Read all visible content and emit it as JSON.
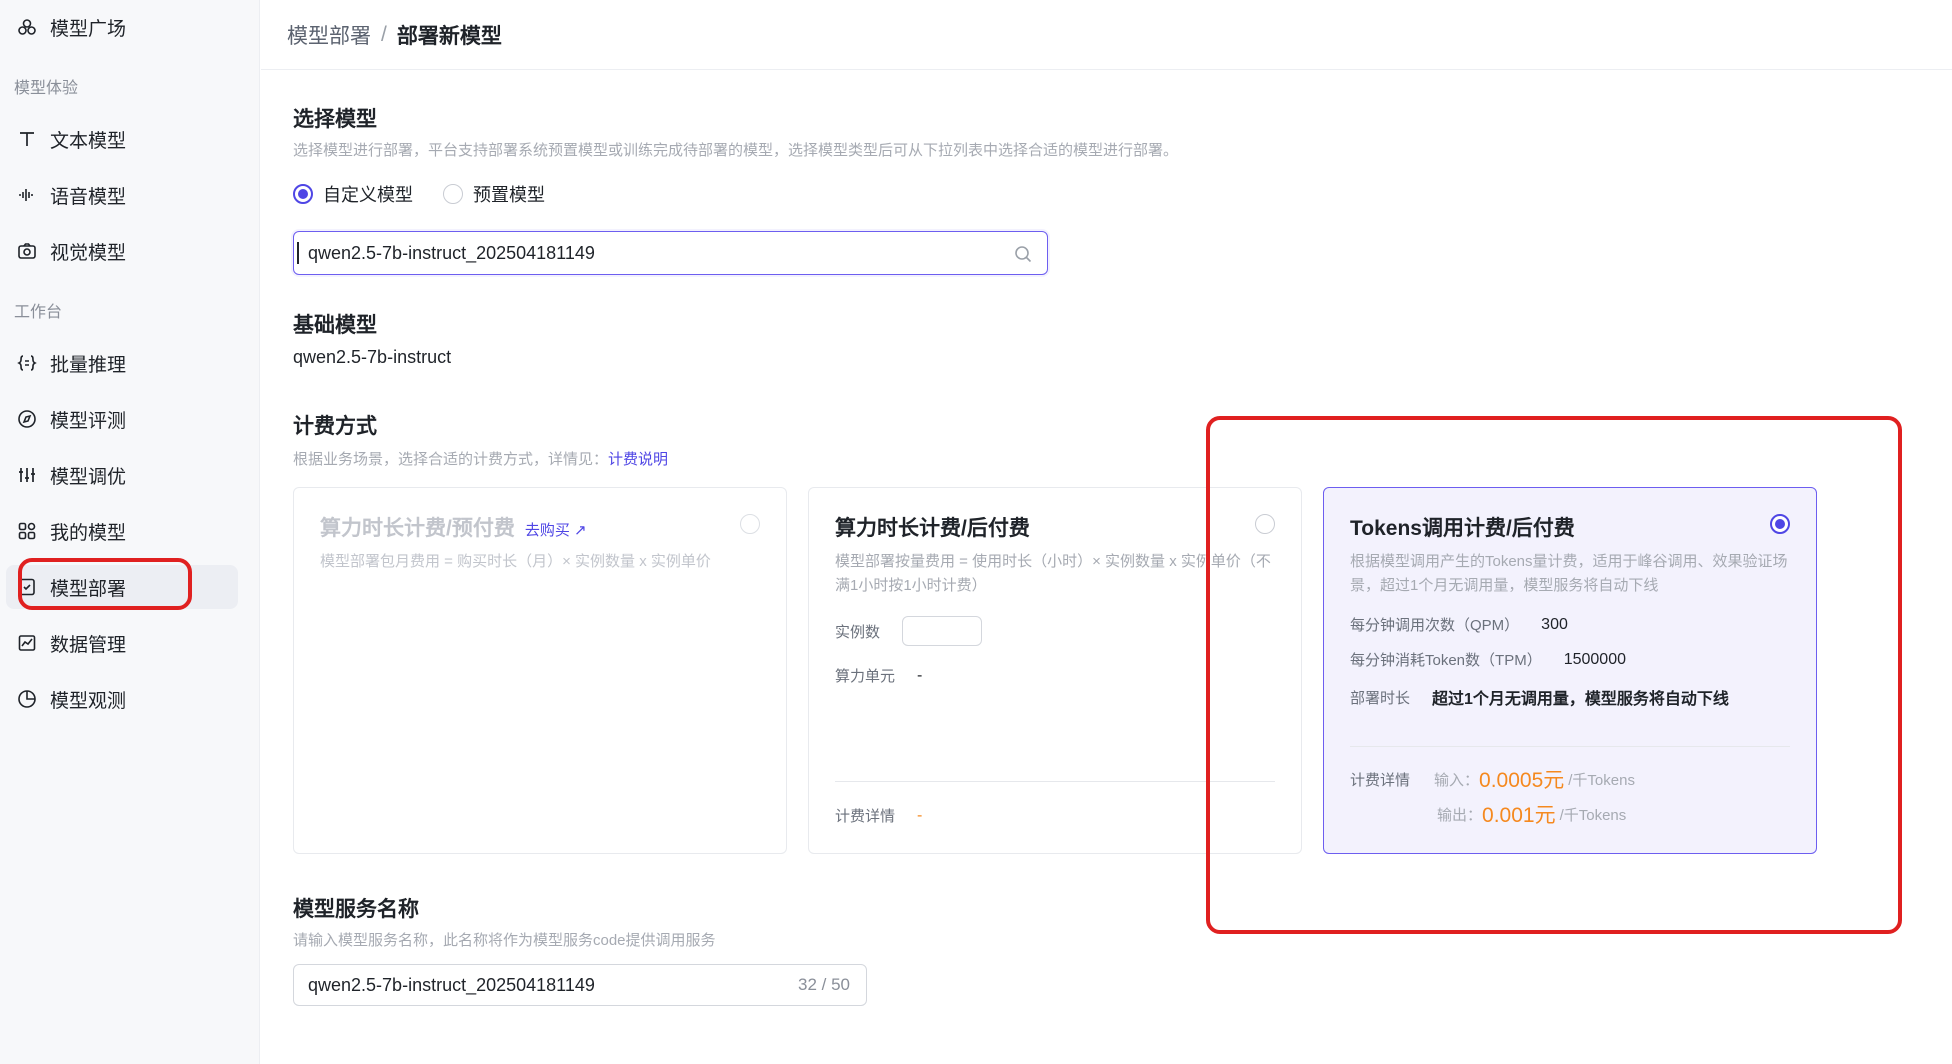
{
  "sidebar": {
    "top_item": {
      "label": "模型广场",
      "icon": "plaza-icon"
    },
    "groups": [
      {
        "label": "模型体验"
      },
      {
        "label": "工作台"
      }
    ],
    "items": [
      {
        "label": "文本模型",
        "icon": "text-icon"
      },
      {
        "label": "语音模型",
        "icon": "audio-wave-icon"
      },
      {
        "label": "视觉模型",
        "icon": "camera-icon"
      },
      {
        "label": "批量推理",
        "icon": "braces-icon"
      },
      {
        "label": "模型评测",
        "icon": "compass-icon"
      },
      {
        "label": "模型调优",
        "icon": "sliders-icon"
      },
      {
        "label": "我的模型",
        "icon": "grid-icon"
      },
      {
        "label": "模型部署",
        "icon": "deploy-icon",
        "active": true
      },
      {
        "label": "数据管理",
        "icon": "chart-icon"
      },
      {
        "label": "模型观测",
        "icon": "pie-icon"
      }
    ]
  },
  "header": {
    "breadcrumb_parent": "模型部署",
    "breadcrumb_sep": "/",
    "breadcrumb_current": "部署新模型"
  },
  "select_model": {
    "title": "选择模型",
    "desc": "选择模型进行部署，平台支持部署系统预置模型或训练完成待部署的模型，选择模型类型后可从下拉列表中选择合适的模型进行部署。",
    "options": [
      {
        "label": "自定义模型",
        "selected": true
      },
      {
        "label": "预置模型",
        "selected": false
      }
    ],
    "value": "qwen2.5-7b-instruct_202504181149"
  },
  "base_model": {
    "title": "基础模型",
    "value": "qwen2.5-7b-instruct"
  },
  "billing": {
    "title": "计费方式",
    "desc": "根据业务场景，选择合适的计费方式，详情见：",
    "desc_link": "计费说明",
    "cards": [
      {
        "title": "算力时长计费/预付费",
        "buy_link": "去购买 ↗",
        "desc": "模型部署包月费用 = 购买时长（月）× 实例数量 x 实例单价",
        "disabled": true
      },
      {
        "title": "算力时长计费/后付费",
        "desc": "模型部署按量费用 = 使用时长（小时）× 实例数量 x 实例单价（不满1小时按1小时计费）",
        "instances_label": "实例数",
        "unit_label": "算力单元",
        "unit_value": "-",
        "detail_label": "计费详情",
        "detail_value": "-"
      },
      {
        "title": "Tokens调用计费/后付费",
        "selected": true,
        "desc": "根据模型调用产生的Tokens量计费，适用于峰谷调用、效果验证场景，超过1个月无调用量，模型服务将自动下线",
        "qpm_label": "每分钟调用次数（QPM）",
        "qpm_value": "300",
        "tpm_label": "每分钟消耗Token数（TPM）",
        "tpm_value": "1500000",
        "duration_label": "部署时长",
        "duration_value": "超过1个月无调用量，模型服务将自动下线",
        "detail_label": "计费详情",
        "input_label": "输入：",
        "input_price": "0.0005元",
        "input_unit": "/千Tokens",
        "output_label": "输出：",
        "output_price": "0.001元",
        "output_unit": "/千Tokens"
      }
    ]
  },
  "service_name": {
    "title": "模型服务名称",
    "desc": "请输入模型服务名称，此名称将作为模型服务code提供调用服务",
    "value": "qwen2.5-7b-instruct_202504181149",
    "count": "32 / 50"
  },
  "colors": {
    "accent": "#4f46e5",
    "price": "#f5891f",
    "annotation": "#e02020"
  }
}
